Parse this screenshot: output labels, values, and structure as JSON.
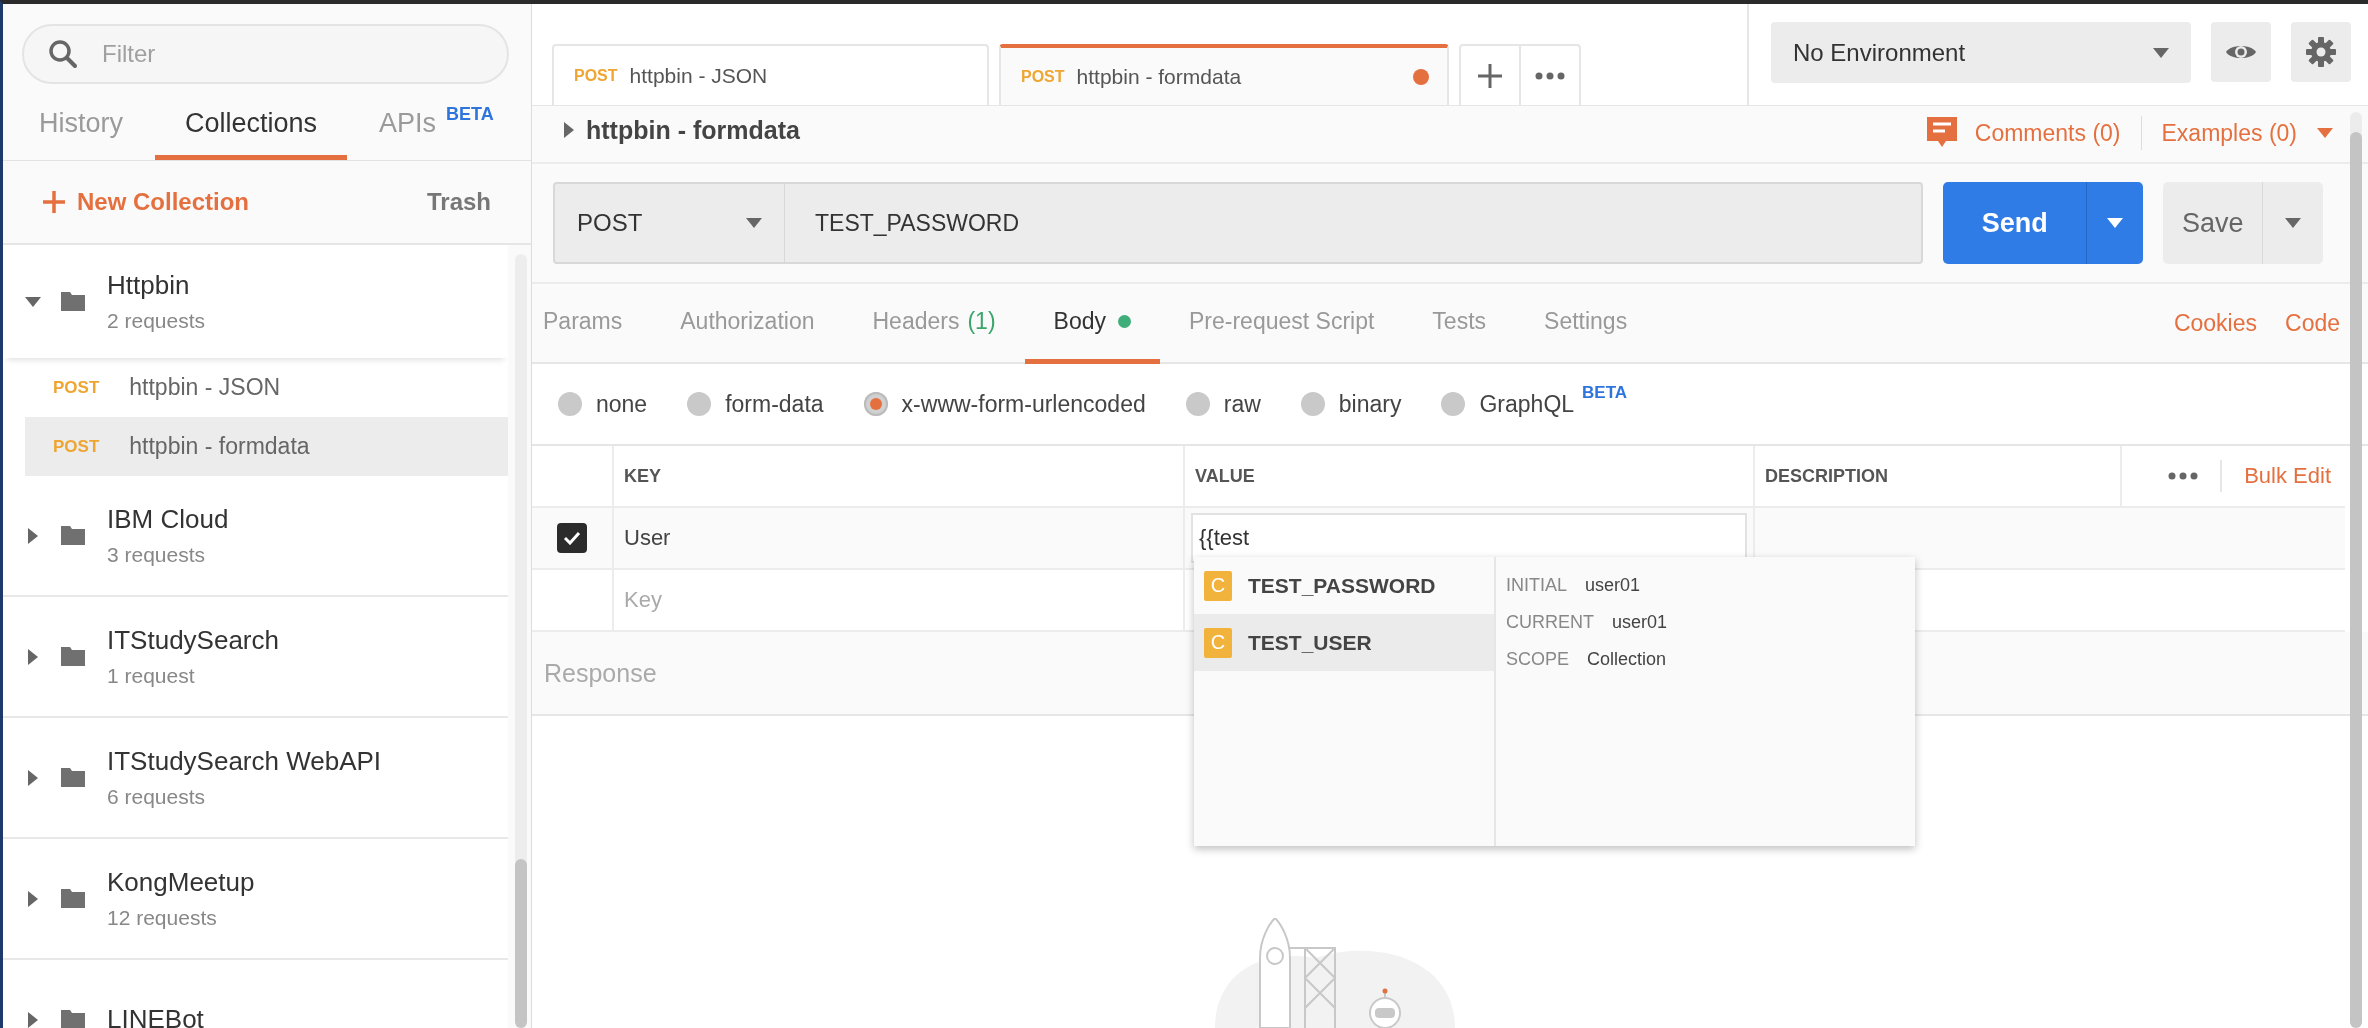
{
  "sidebar": {
    "filter": {
      "placeholder": "Filter"
    },
    "tabs": [
      {
        "label": "History",
        "selected": false
      },
      {
        "label": "Collections",
        "selected": true
      },
      {
        "label": "APIs",
        "badge": "BETA",
        "selected": false
      }
    ],
    "new_collection": "New Collection",
    "trash": "Trash",
    "collections": [
      {
        "name": "Httpbin",
        "count": "2 requests",
        "expanded": true,
        "children": [
          {
            "method": "POST",
            "name": "httpbin - JSON",
            "selected": false
          },
          {
            "method": "POST",
            "name": "httpbin - formdata",
            "selected": true
          }
        ]
      },
      {
        "name": "IBM Cloud",
        "count": "3 requests",
        "expanded": false
      },
      {
        "name": "ITStudySearch",
        "count": "1 request",
        "expanded": false
      },
      {
        "name": "ITStudySearch WebAPI",
        "count": "6 requests",
        "expanded": false
      },
      {
        "name": "KongMeetup",
        "count": "12 requests",
        "expanded": false
      },
      {
        "name": "LINEBot",
        "expanded": false
      }
    ]
  },
  "request_tabs": [
    {
      "method": "POST",
      "name": "httpbin - JSON",
      "selected": false,
      "unsaved": false
    },
    {
      "method": "POST",
      "name": "httpbin - formdata",
      "selected": true,
      "unsaved": true
    }
  ],
  "environment": {
    "value": "No Environment"
  },
  "request": {
    "title": "httpbin - formdata",
    "comments": "Comments (0)",
    "examples": "Examples (0)",
    "method": "POST",
    "url": "TEST_PASSWORD",
    "send": "Send",
    "save": "Save"
  },
  "section_tabs": [
    {
      "label": "Params",
      "selected": false,
      "modified": false
    },
    {
      "label": "Authorization",
      "selected": false,
      "modified": false
    },
    {
      "label": "Headers",
      "count": "(1)",
      "selected": false,
      "modified": false
    },
    {
      "label": "Body",
      "selected": true,
      "modified": true
    },
    {
      "label": "Pre-request Script",
      "selected": false,
      "modified": false
    },
    {
      "label": "Tests",
      "selected": false,
      "modified": false
    },
    {
      "label": "Settings",
      "selected": false,
      "modified": false
    }
  ],
  "section_links": [
    "Cookies",
    "Code"
  ],
  "body_types": [
    {
      "label": "none",
      "selected": false
    },
    {
      "label": "form-data",
      "selected": false
    },
    {
      "label": "x-www-form-urlencoded",
      "selected": true
    },
    {
      "label": "raw",
      "selected": false
    },
    {
      "label": "binary",
      "selected": false
    },
    {
      "label": "GraphQL",
      "badge": "BETA",
      "selected": false
    }
  ],
  "params": {
    "columns": [
      "KEY",
      "VALUE",
      "DESCRIPTION"
    ],
    "bulk_edit": "Bulk Edit",
    "rows": [
      {
        "kind": "entry",
        "checked": true,
        "key": "User",
        "value": "{{test"
      },
      {
        "kind": "new",
        "key_placeholder": "Key"
      }
    ]
  },
  "autocomplete": {
    "items": [
      {
        "scope": "C",
        "name": "TEST_PASSWORD",
        "selected": false
      },
      {
        "scope": "C",
        "name": "TEST_USER",
        "selected": true
      }
    ],
    "details": [
      {
        "label": "INITIAL",
        "value": "user01"
      },
      {
        "label": "CURRENT",
        "value": "user01"
      },
      {
        "label": "SCOPE",
        "value": "Collection"
      }
    ]
  },
  "response": {
    "label": "Response"
  }
}
